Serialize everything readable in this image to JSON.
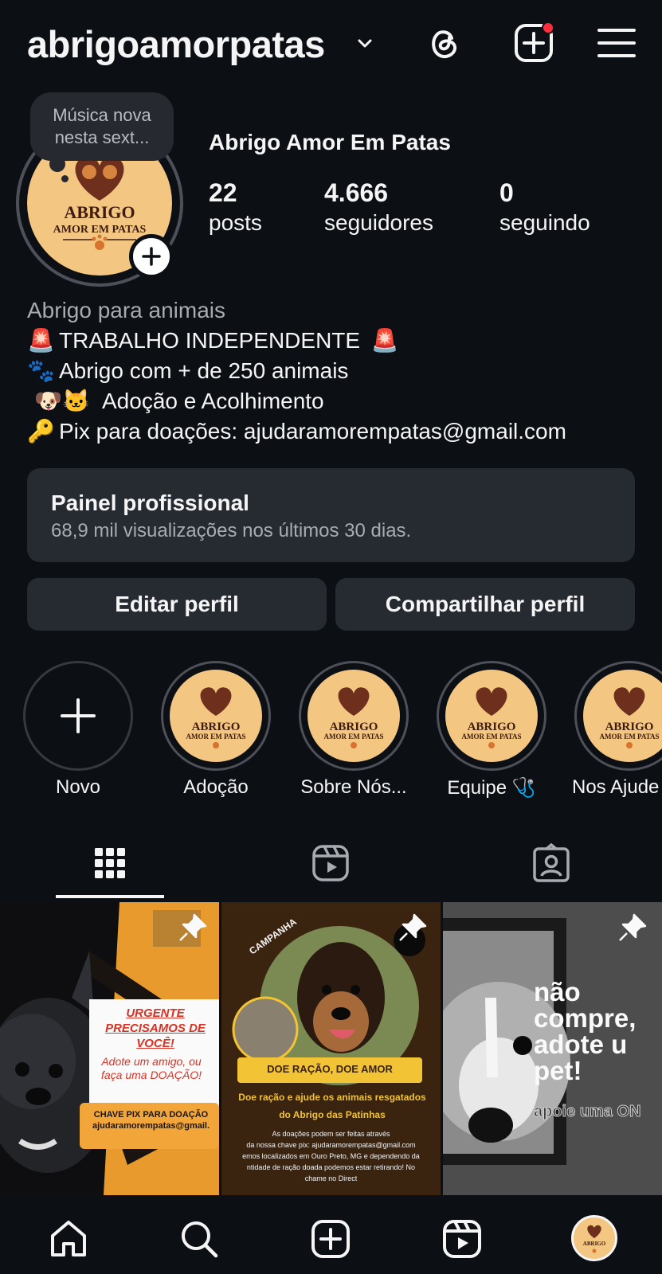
{
  "header": {
    "username": "abrigoamorpatas",
    "icons": [
      "threads-icon",
      "create-icon",
      "menu-icon"
    ],
    "notification_color": "#ff2d3f"
  },
  "profile": {
    "note": "Música nova nesta sext...",
    "display_name": "Abrigo Amor Em Patas",
    "logo": {
      "line1": "ABRIGO",
      "line2": "AMOR EM PATAS"
    },
    "stats": [
      {
        "value": "22",
        "label": "posts"
      },
      {
        "value": "4.666",
        "label": "seguidores"
      },
      {
        "value": "0",
        "label": "seguindo"
      }
    ],
    "bio": {
      "category": "Abrigo para animais",
      "lines": [
        {
          "emoji": "🚨",
          "text": "TRABALHO INDEPENDENTE",
          "emoji_end": "🚨"
        },
        {
          "emoji": "🐾",
          "text": "Abrigo com + de 250 animais"
        },
        {
          "emoji": "🐶🐱",
          "text": "Adoção e Acolhimento"
        },
        {
          "emoji": "🔑",
          "text": "Pix para doações: ajudaramorempatas@gmail.com"
        }
      ]
    }
  },
  "professional_panel": {
    "title": "Painel profissional",
    "subtitle": "68,9 mil visualizações nos últimos 30 dias."
  },
  "buttons": {
    "edit": "Editar perfil",
    "share": "Compartilhar perfil"
  },
  "highlights": [
    {
      "label": "Novo"
    },
    {
      "label": "Adoção"
    },
    {
      "label": "Sobre Nós..."
    },
    {
      "label": "Equipe 🩺"
    },
    {
      "label": "Nos Ajude"
    }
  ],
  "tabs": [
    "grid-icon",
    "reels-icon",
    "tagged-icon"
  ],
  "posts": [
    {
      "headline": "URGENTE PRECISAMOS DE VOCÊ!",
      "line1": "Adote um amigo, ou",
      "line2": "faça uma DOAÇÃO!",
      "pix_label": "CHAVE PIX PARA DOAÇÃO",
      "pix_value": "ajudaramorempatas@gmail.",
      "accent": "#e89b2c"
    },
    {
      "tag": "CAMPANHA",
      "banner": "DOE RAÇÃO, DOE AMOR",
      "line1": "Doe ração e ajude os animais resgatados",
      "line2": "do Abrigo das Patinhas",
      "small1": "As doações podem ser feitas através",
      "small2": "da nossa chave pix: ajudaramorempatas@gmail.com",
      "small3": "emos localizados em Ouro Preto, MG e dependendo da",
      "small4": "ntidade de ração doada podemos estar retirando! No",
      "small5": "chame no Direct",
      "accent": "#f2c335"
    },
    {
      "text": "não compre, adote um pet!",
      "line1": "não",
      "line2": "compre,",
      "line3": "adote u",
      "line4": "pet!",
      "sub": "apoie uma ON"
    }
  ],
  "bottom_nav": [
    "home-icon",
    "search-icon",
    "create-icon",
    "reels-icon",
    "profile-avatar"
  ]
}
